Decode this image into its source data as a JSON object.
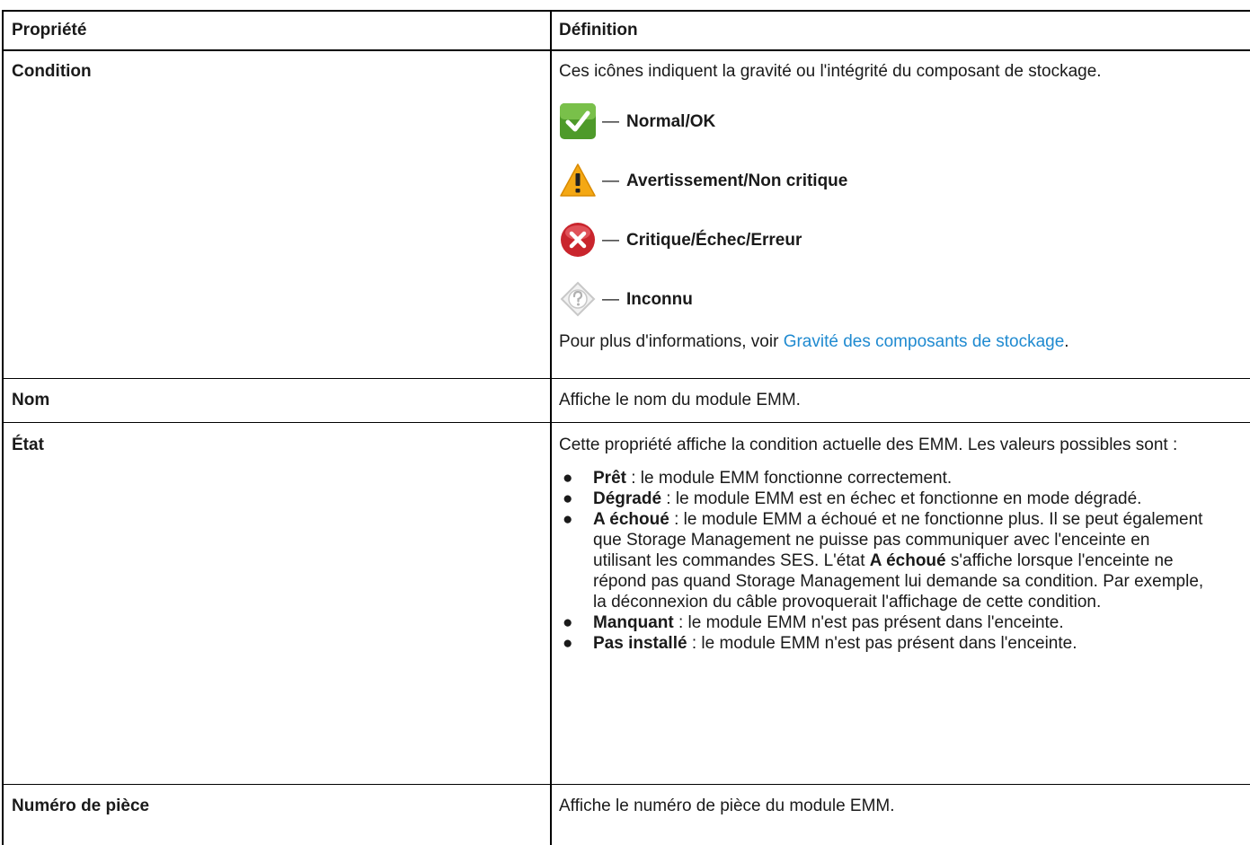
{
  "table": {
    "header": {
      "property": "Propriété",
      "definition": "Définition"
    },
    "rows": {
      "condition": {
        "property": "Condition",
        "intro": "Ces icônes indiquent la gravité ou l'intégrité du composant de stockage.",
        "dash": "—",
        "icons": [
          {
            "icon": "ok-check-icon",
            "label": "Normal/OK",
            "color": "#4e9a2a"
          },
          {
            "icon": "warning-triangle-icon",
            "label": "Avertissement/Non critique",
            "color": "#f4a814"
          },
          {
            "icon": "critical-x-icon",
            "label": "Critique/Échec/Erreur",
            "color": "#c9252d"
          },
          {
            "icon": "unknown-question-icon",
            "label": "Inconnu",
            "color": "#c8c8c8"
          }
        ],
        "more_prefix": "Pour plus d'informations, voir ",
        "more_link": "Gravité des composants de stockage",
        "more_suffix": "."
      },
      "nom": {
        "property": "Nom",
        "definition": "Affiche le nom du module EMM."
      },
      "etat": {
        "property": "État",
        "intro": "Cette propriété affiche la condition actuelle des EMM. Les valeurs possibles sont :",
        "bullet": "●",
        "states": [
          {
            "term": "Prêt",
            "text": " : le module EMM fonctionne correctement."
          },
          {
            "term": "Dégradé",
            "text": " : le module EMM est en échec et fonctionne en mode dégradé."
          },
          {
            "term": "A échoué",
            "text_a": " : le module EMM a échoué et ne fonctionne plus. Il se peut également que Storage Management ne puisse pas communiquer avec l'enceinte en utilisant les commandes SES. L'état ",
            "term_b": "A échoué",
            "text_b": " s'affiche lorsque l'enceinte ne répond pas quand Storage Management lui demande sa condition. Par exemple, la déconnexion du câble provoquerait l'affichage de cette condition."
          },
          {
            "term": "Manquant",
            "text": " : le module EMM n'est pas présent dans l'enceinte."
          },
          {
            "term": "Pas installé",
            "text": " : le module EMM n'est pas présent dans l'enceinte."
          }
        ]
      },
      "numero": {
        "property": "Numéro de pièce",
        "definition": "Affiche le numéro de pièce du module EMM."
      }
    }
  }
}
